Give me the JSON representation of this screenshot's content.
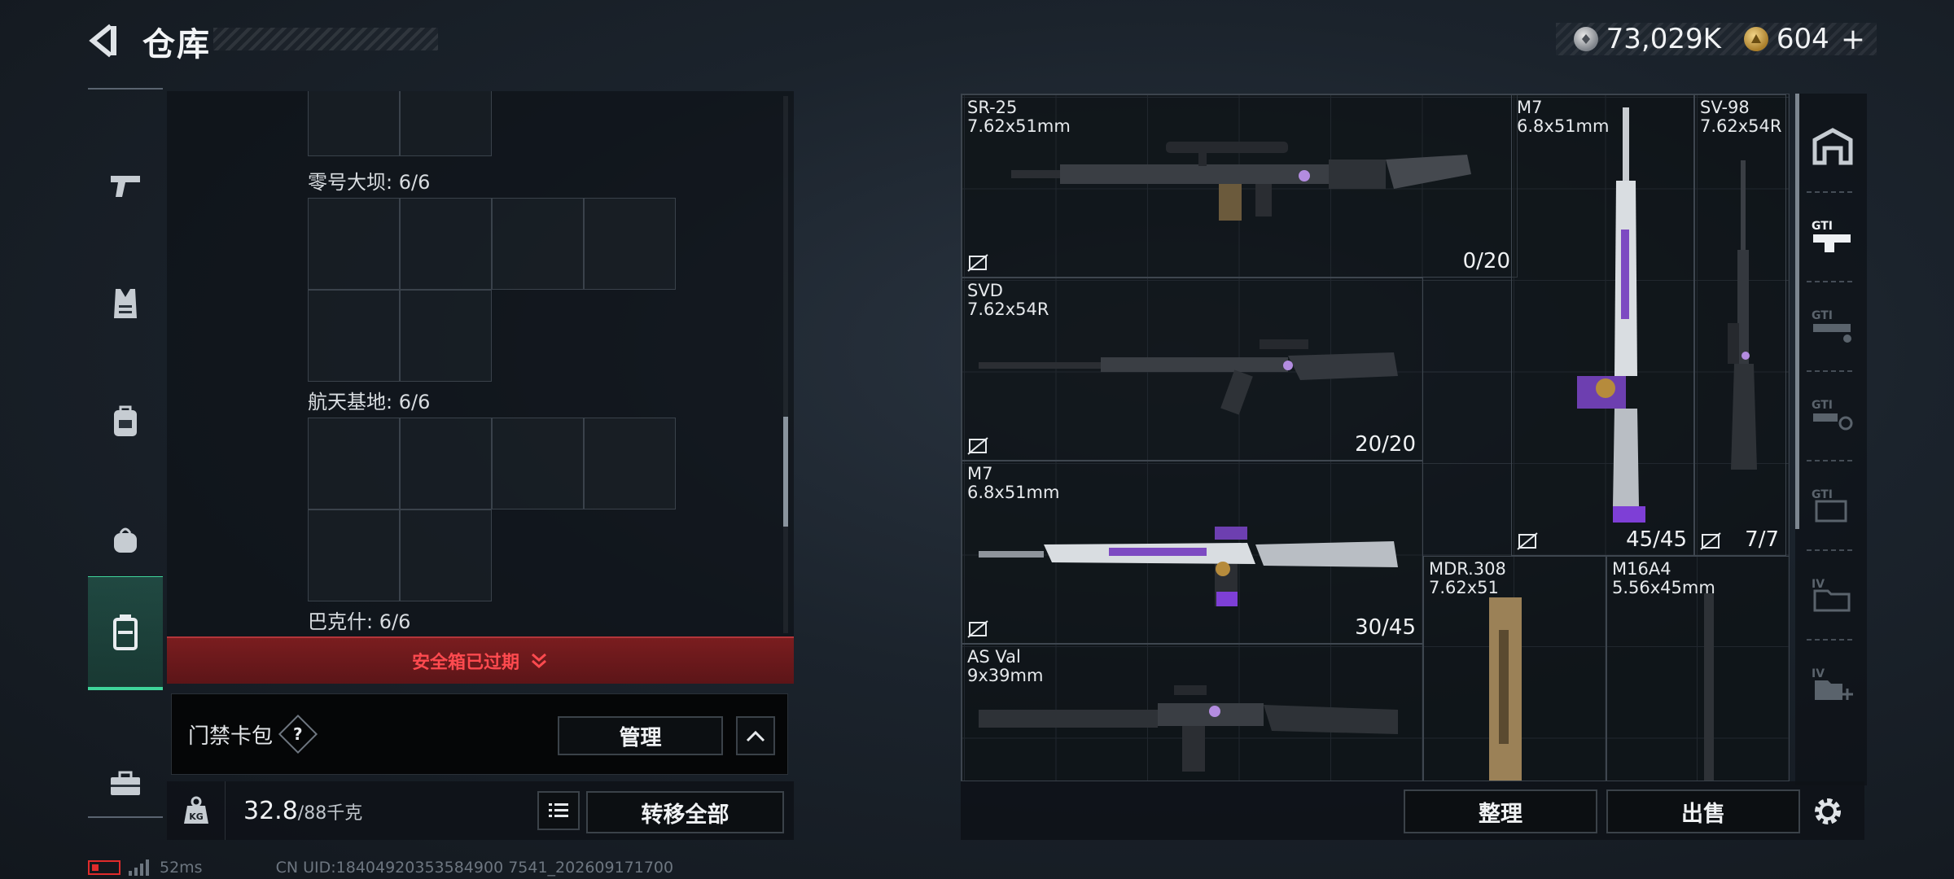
{
  "header": {
    "title": "仓库",
    "currency_silver": "73,029K",
    "currency_gold": "604",
    "plus_label": "+"
  },
  "left_panel": {
    "keys": [
      {
        "label": "零号大坝: 6/6"
      },
      {
        "label": "航天基地: 6/6"
      },
      {
        "label": "巴克什: 6/6"
      }
    ],
    "expired_notice": "安全箱已过期",
    "card_pack_label": "门禁卡包",
    "help_symbol": "?",
    "manage_label": "管理",
    "weight_current": "32.8",
    "weight_max": "/88千克",
    "kg_label": "KG",
    "transfer_all_label": "转移全部"
  },
  "weapons": [
    {
      "name": "SR-25",
      "ammo": "7.62x51mm",
      "count": "0/20"
    },
    {
      "name": "SVD",
      "ammo": "7.62x54R",
      "count": "20/20"
    },
    {
      "name": "M7",
      "ammo": "6.8x51mm",
      "count": "30/45"
    },
    {
      "name": "AS Val",
      "ammo": "9x39mm",
      "count": ""
    },
    {
      "name": "M7",
      "ammo": "6.8x51mm",
      "count": "45/45"
    },
    {
      "name": "SV-98",
      "ammo": "7.62x54R",
      "count": "7/7"
    },
    {
      "name": "MDR.308",
      "ammo": "7.62x51",
      "count": ""
    },
    {
      "name": "M16A4",
      "ammo": "5.56x45mm",
      "count": ""
    }
  ],
  "right_sidebar": {
    "tabs": [
      "warehouse-home",
      "gti-1",
      "gti-2",
      "gti-3",
      "gti-4",
      "iv-1",
      "iv-add"
    ]
  },
  "bottom": {
    "sort_label": "整理",
    "sell_label": "出售"
  },
  "status": {
    "ping": "52ms",
    "uid": "CN UID:18404920353584900 7541_202609171700"
  },
  "colors": {
    "accent_green": "#3fd49a",
    "alert_red": "#ff4a4f"
  }
}
